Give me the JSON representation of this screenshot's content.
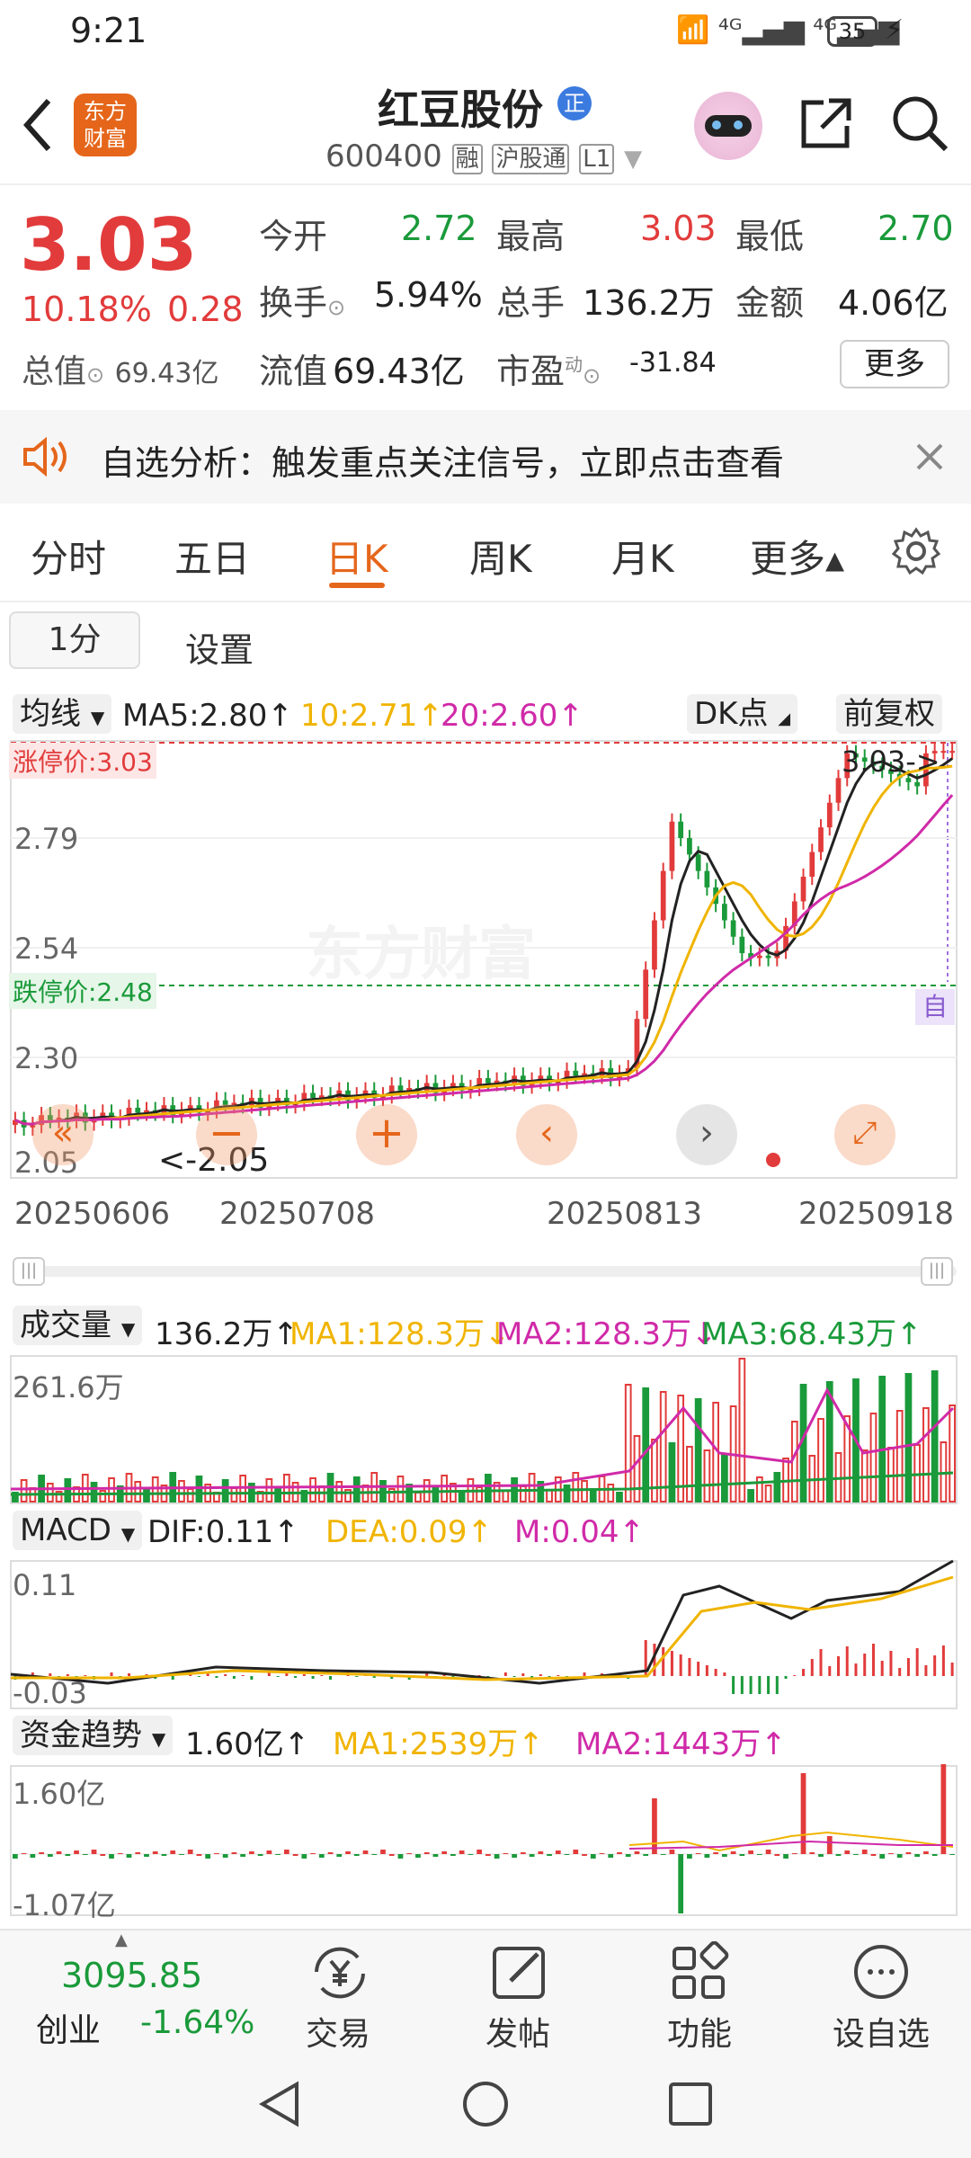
{
  "status": {
    "time": "9:21",
    "battery": "35"
  },
  "header": {
    "name": "红豆股份",
    "badge": "正",
    "code": "600400",
    "tags": [
      "融",
      "沪股通",
      "L1"
    ],
    "app_logo": "东方\n财富"
  },
  "quote": {
    "price": "3.03",
    "pct": "10.18%",
    "chg": "0.28",
    "open_label": "今开",
    "open": "2.72",
    "high_label": "最高",
    "high": "3.03",
    "low_label": "最低",
    "low": "2.70",
    "turn_label": "换手",
    "turn": "5.94%",
    "vol_label": "总手",
    "vol": "136.2万",
    "amt_label": "金额",
    "amt": "4.06亿",
    "mcap_label": "总值",
    "mcap": "69.43亿",
    "float_label": "流值",
    "float": "69.43亿",
    "pe_label": "市盈",
    "pe_sup": "动",
    "pe": "-31.84",
    "more": "更多"
  },
  "alert": {
    "text": "自选分析：触发重点关注信号，立即点击查看"
  },
  "tabs": [
    "分时",
    "五日",
    "日K",
    "周K",
    "月K",
    "更多▴"
  ],
  "subtabs": {
    "minute": "1分",
    "settings": "设置"
  },
  "kline": {
    "indicator": "均线",
    "ma5": "MA5:2.80↑",
    "ma10": "10:2.71↑",
    "ma20": "20:2.60↑",
    "dk": "DK点",
    "adj": "前复权",
    "limit_up": "涨停价:3.03",
    "limit_down": "跌停价:2.48",
    "y_labels": [
      "3.03",
      "2.79",
      "2.54",
      "2.30",
      "2.05"
    ],
    "max_mark": "3.03->",
    "min_mark": "<-2.05",
    "self": "自",
    "watermark": "东方财富",
    "dates": [
      "20250606",
      "20250708",
      "20250813",
      "20250918"
    ]
  },
  "volume": {
    "name": "成交量",
    "val": "136.2万↑",
    "ma1": "MA1:128.3万↓",
    "ma2": "MA2:128.3万↓",
    "ma3": "MA3:68.43万↑",
    "top": "261.6万"
  },
  "macd": {
    "name": "MACD",
    "dif": "DIF:0.11↑",
    "dea": "DEA:0.09↑",
    "m": "M:0.04↑",
    "top": "0.11",
    "bottom": "-0.03"
  },
  "fund": {
    "name": "资金趋势",
    "val": "1.60亿↑",
    "ma1": "MA1:2539万↑",
    "ma2": "MA2:1443万↑",
    "top": "1.60亿",
    "bottom": "-1.07亿"
  },
  "bottom": {
    "index_val": "3095.85",
    "index_name": "创业",
    "index_pct": "-1.64%",
    "trade": "交易",
    "post": "发帖",
    "func": "功能",
    "add": "设自选"
  },
  "colors": {
    "up": "#e23b3b",
    "down": "#1a9a3a",
    "ma10": "#f0b400",
    "ma20": "#d02aa8",
    "accent": "#e5661b"
  }
}
